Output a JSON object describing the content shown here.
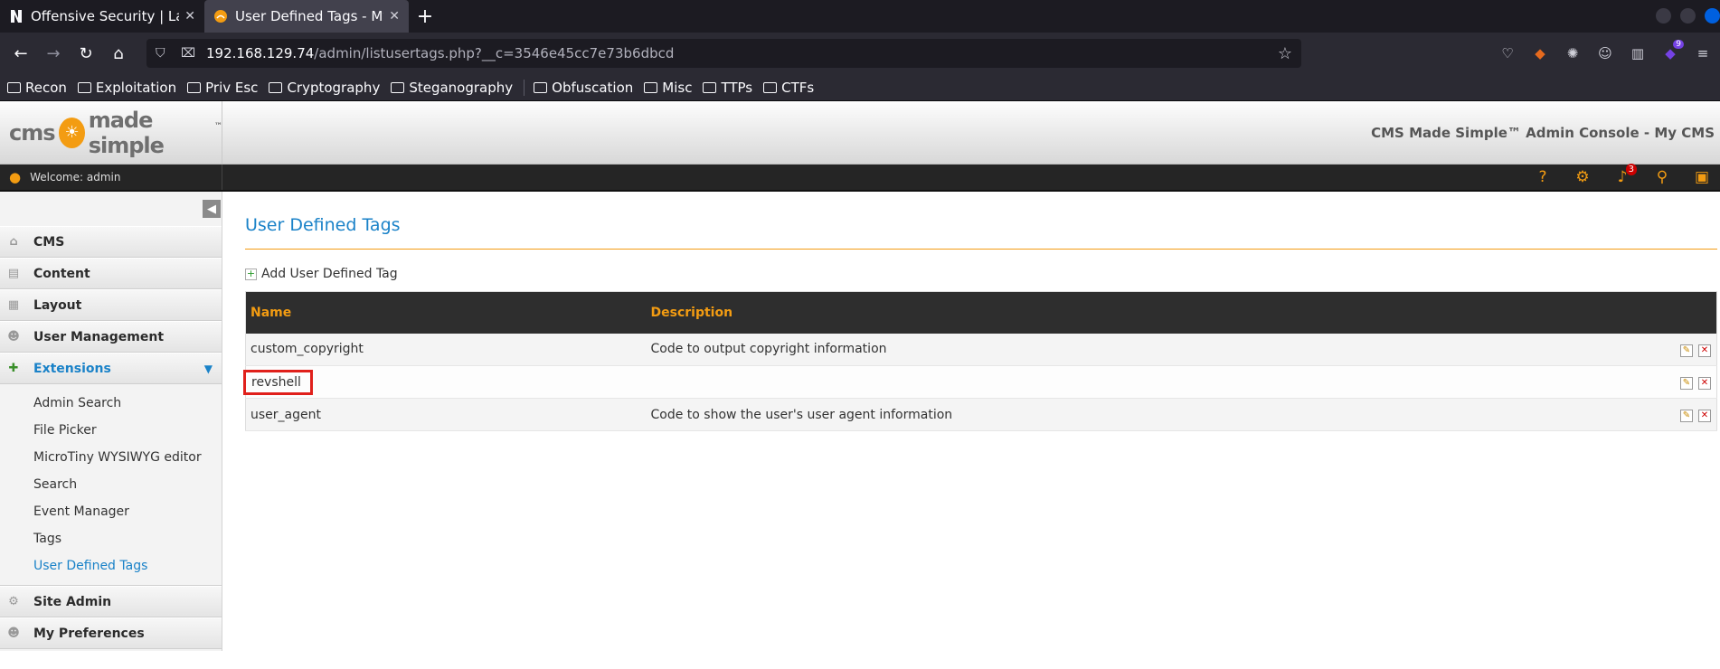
{
  "browser": {
    "tabs": [
      {
        "title": "Offensive Security | Labs |",
        "active": false
      },
      {
        "title": "User Defined Tags - My Cl",
        "active": true
      }
    ],
    "url_host": "192.168.129.74",
    "url_path": "/admin/listusertags.php?__c=3546e45cc7e73b6dbcd",
    "extension_badge": "9",
    "bookmarks": [
      "Recon",
      "Exploitation",
      "Priv Esc",
      "Cryptography",
      "Steganography",
      "Obfuscation",
      "Misc",
      "TTPs",
      "CTFs"
    ]
  },
  "cms": {
    "console_title": "CMS Made Simple™ Admin Console - My CMS",
    "welcome": "Welcome: admin",
    "notifications": "3",
    "logo_left": "cms",
    "logo_right": "made simple",
    "logo_tm": "™"
  },
  "sidebar": {
    "items": [
      {
        "label": "CMS",
        "icon": "home-icon"
      },
      {
        "label": "Content",
        "icon": "content-icon"
      },
      {
        "label": "Layout",
        "icon": "layout-icon"
      },
      {
        "label": "User Management",
        "icon": "users-icon"
      },
      {
        "label": "Extensions",
        "icon": "puzzle-icon"
      },
      {
        "label": "Site Admin",
        "icon": "gear-icon"
      },
      {
        "label": "My Preferences",
        "icon": "user-icon"
      }
    ],
    "submenu": [
      "Admin Search",
      "File Picker",
      "MicroTiny WYSIWYG editor",
      "Search",
      "Event Manager",
      "Tags",
      "User Defined Tags"
    ]
  },
  "main": {
    "title": "User Defined Tags",
    "add_label": "Add User Defined Tag",
    "columns": [
      "Name",
      "Description"
    ],
    "rows": [
      {
        "name": "custom_copyright",
        "description": "Code to output copyright information"
      },
      {
        "name": "revshell",
        "description": ""
      },
      {
        "name": "user_agent",
        "description": "Code to show the user's user agent information"
      }
    ]
  }
}
